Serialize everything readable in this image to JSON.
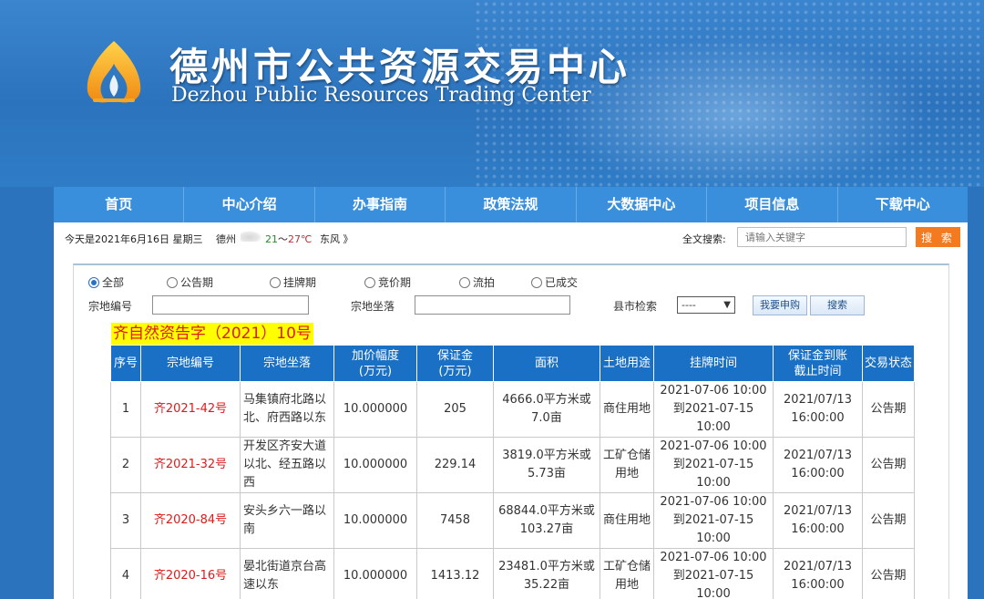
{
  "header": {
    "title_cn": "德州市公共资源交易中心",
    "title_en": "Dezhou Public Resources Trading Center",
    "logo_icon": "flame-a-logo-icon"
  },
  "nav": {
    "items": [
      "首页",
      "中心介绍",
      "办事指南",
      "政策法规",
      "大数据中心",
      "项目信息",
      "下载中心"
    ]
  },
  "infobar": {
    "date": "今天是2021年6月16日 星期三",
    "city": "德州",
    "weather_icon": "cloud-icon",
    "temp_low": "21",
    "temp_sep": "～",
    "temp_high": "27℃",
    "wind": "东风 》",
    "search_label": "全文搜索:",
    "search_placeholder": "请输入关键字",
    "search_button": "搜 索"
  },
  "filters": {
    "status_options": [
      {
        "label": "全部",
        "selected": true
      },
      {
        "label": "公告期",
        "selected": false
      },
      {
        "label": "挂牌期",
        "selected": false
      },
      {
        "label": "竞价期",
        "selected": false
      },
      {
        "label": "流拍",
        "selected": false
      },
      {
        "label": "已成交",
        "selected": false
      }
    ],
    "code_label": "宗地编号",
    "location_label": "宗地坐落",
    "county_label": "县市检索",
    "county_value": "----",
    "apply_button": "我要申购",
    "search_button": "搜索"
  },
  "notice_title": "齐自然资告字（2021）10号",
  "table": {
    "headers": [
      "序号",
      "宗地编号",
      "宗地坐落",
      "加价幅度\n(万元)",
      "保证金\n(万元)",
      "面积",
      "土地用途",
      "挂牌时间",
      "保证金到账\n截止时间",
      "交易状态"
    ],
    "rows": [
      {
        "no": "1",
        "code": "齐2021-42号",
        "location": "马集镇府北路以北、府西路以东",
        "increment": "10.000000",
        "deposit": "205",
        "area": "4666.0平方米或7.0亩",
        "use": "商住用地",
        "period": "2021-07-06 10:00到2021-07-15 10:00",
        "deadline": "2021/07/13 16:00:00",
        "status": "公告期"
      },
      {
        "no": "2",
        "code": "齐2021-32号",
        "location": "开发区齐安大道以北、经五路以西",
        "increment": "10.000000",
        "deposit": "229.14",
        "area": "3819.0平方米或5.73亩",
        "use": "工矿仓储用地",
        "period": "2021-07-06 10:00到2021-07-15 10:00",
        "deadline": "2021/07/13 16:00:00",
        "status": "公告期"
      },
      {
        "no": "3",
        "code": "齐2020-84号",
        "location": "安头乡六一路以南",
        "increment": "10.000000",
        "deposit": "7458",
        "area": "68844.0平方米或103.27亩",
        "use": "商住用地",
        "period": "2021-07-06 10:00到2021-07-15 10:00",
        "deadline": "2021/07/13 16:00:00",
        "status": "公告期"
      },
      {
        "no": "4",
        "code": "齐2020-16号",
        "location": "晏北街道京台高速以东",
        "increment": "10.000000",
        "deposit": "1413.12",
        "area": "23481.0平方米或35.22亩",
        "use": "工矿仓储用地",
        "period": "2021-07-06 10:00到2021-07-15 10:00",
        "deadline": "2021/07/13 16:00:00",
        "status": "公告期"
      }
    ]
  }
}
